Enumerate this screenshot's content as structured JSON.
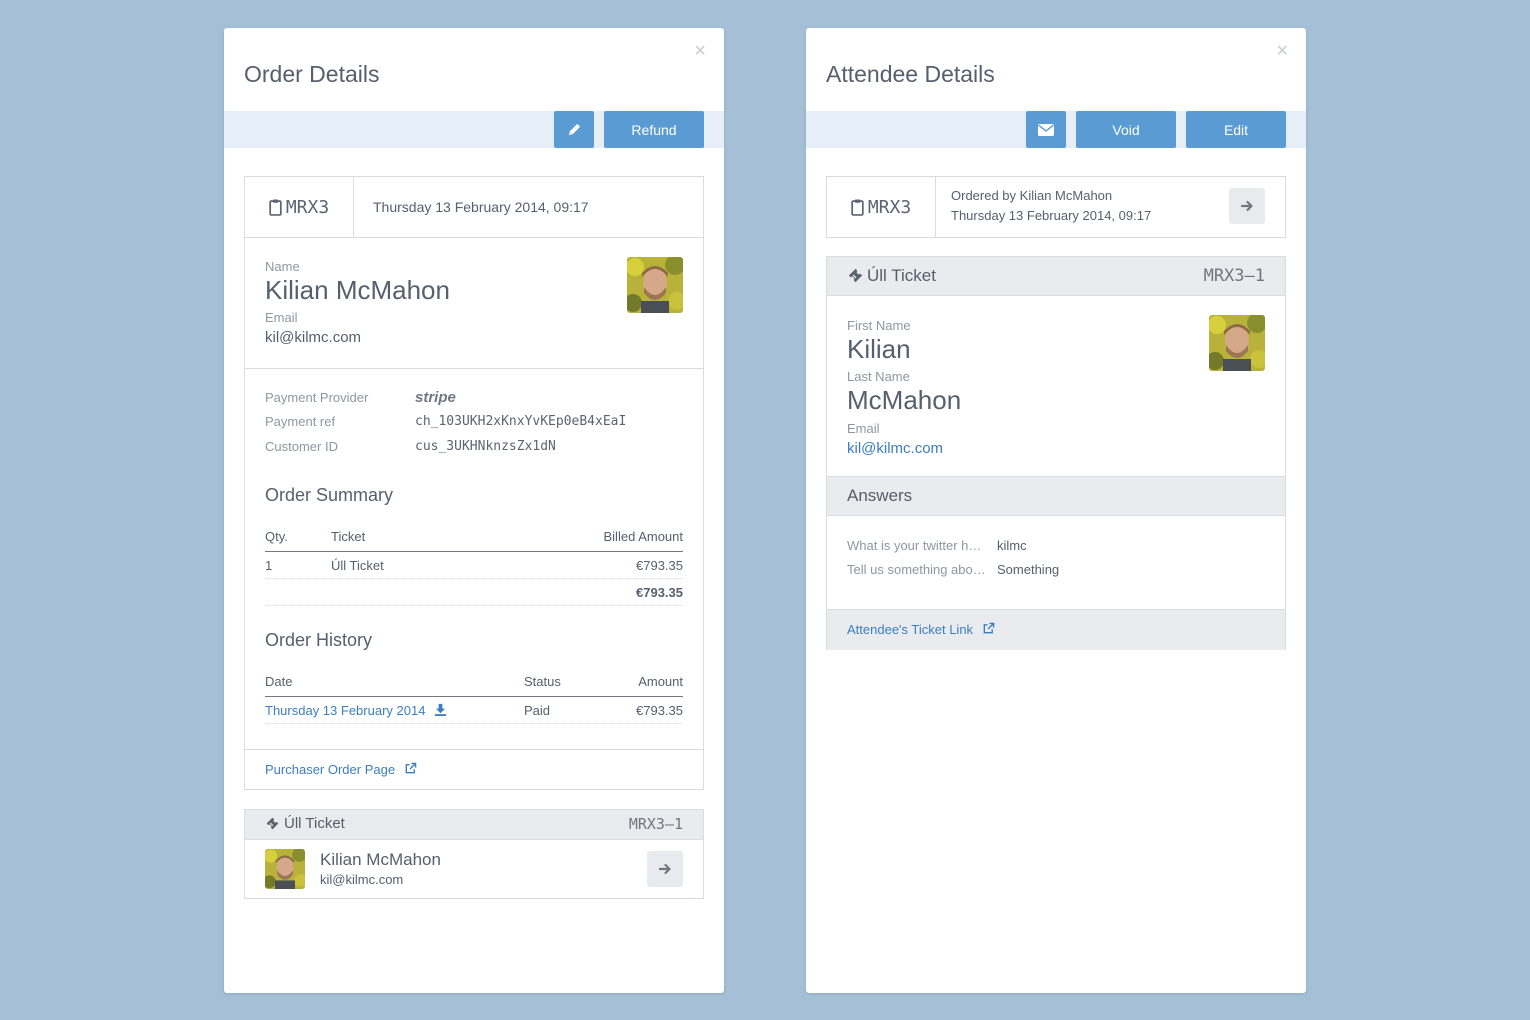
{
  "order_modal": {
    "title": "Order Details",
    "close": "×",
    "refund_label": "Refund",
    "order_ref": "MRX3",
    "order_date": "Thursday 13 February 2014, 09:17",
    "name_label": "Name",
    "name": "Kilian McMahon",
    "email_label": "Email",
    "email": "kil@kilmc.com",
    "payment": {
      "provider_label": "Payment Provider",
      "provider": "stripe",
      "ref_label": "Payment ref",
      "ref": "ch_103UKH2xKnxYvKEp0eB4xEaI",
      "customer_label": "Customer ID",
      "customer": "cus_3UKHNknzsZx1dN"
    },
    "summary": {
      "title": "Order Summary",
      "col_qty": "Qty.",
      "col_ticket": "Ticket",
      "col_amount": "Billed Amount",
      "row_qty": "1",
      "row_ticket": "Úll Ticket",
      "row_amount": "€793.35",
      "total": "€793.35"
    },
    "history": {
      "title": "Order History",
      "col_date": "Date",
      "col_status": "Status",
      "col_amount": "Amount",
      "row_date": "Thursday 13 February 2014",
      "row_status": "Paid",
      "row_amount": "€793.35"
    },
    "purchaser_link": "Purchaser Order Page",
    "ticket": {
      "name": "Úll Ticket",
      "ref": "MRX3–1",
      "holder_name": "Kilian McMahon",
      "holder_email": "kil@kilmc.com"
    }
  },
  "attendee_modal": {
    "title": "Attendee Details",
    "close": "×",
    "void_label": "Void",
    "edit_label": "Edit",
    "order_ref": "MRX3",
    "ordered_by": "Ordered by Kilian McMahon",
    "order_date": "Thursday 13 February 2014, 09:17",
    "ticket_name": "Úll Ticket",
    "ticket_ref": "MRX3–1",
    "first_name_label": "First Name",
    "first_name": "Kilian",
    "last_name_label": "Last Name",
    "last_name": "McMahon",
    "email_label": "Email",
    "email": "kil@kilmc.com",
    "answers_title": "Answers",
    "answers": [
      {
        "q": "What is your twitter h…",
        "a": "kilmc"
      },
      {
        "q": "Tell us something abo…",
        "a": "Something"
      }
    ],
    "ticket_link": "Attendee's Ticket Link"
  },
  "colors": {
    "background": "#a4bfd6",
    "button": "#5a9bd4",
    "link": "#3c7ec1",
    "toolbar": "#e6eef7"
  },
  "icons": [
    "close-icon",
    "pencil-icon",
    "envelope-icon",
    "clipboard-icon",
    "ticket-icon",
    "arrow-right-icon",
    "download-icon",
    "external-link-icon"
  ]
}
